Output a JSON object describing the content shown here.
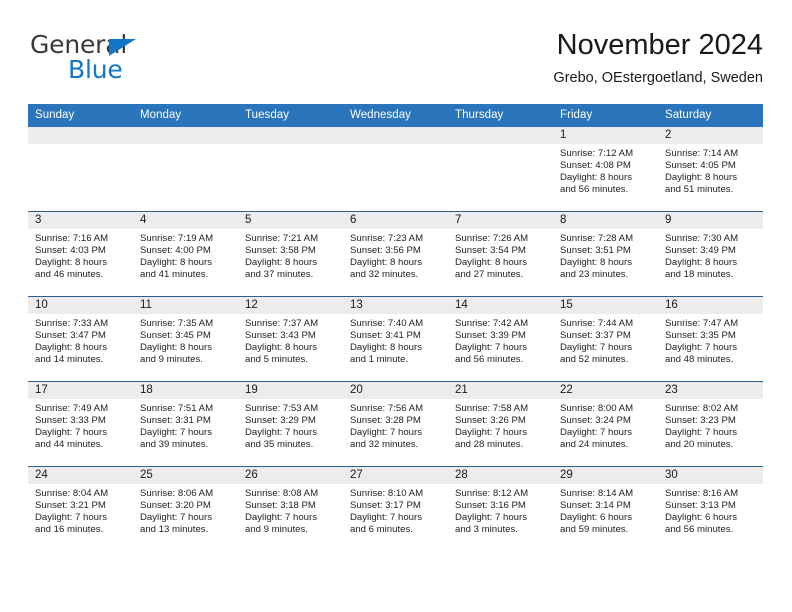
{
  "logo": {
    "word1": "General",
    "word2": "Blue",
    "triangle_color": "#1477c6"
  },
  "header": {
    "title": "November 2024",
    "subtitle": "Grebo, OEstergoetland, Sweden"
  },
  "theme": {
    "header_bg": "#2a74bb",
    "header_text": "#ffffff",
    "date_band_bg": "#ececec",
    "row_divider": "#2f5f8f"
  },
  "calendar": {
    "weekdays": [
      "Sunday",
      "Monday",
      "Tuesday",
      "Wednesday",
      "Thursday",
      "Friday",
      "Saturday"
    ],
    "weeks": [
      [
        {
          "day": "",
          "lines": []
        },
        {
          "day": "",
          "lines": []
        },
        {
          "day": "",
          "lines": []
        },
        {
          "day": "",
          "lines": []
        },
        {
          "day": "",
          "lines": []
        },
        {
          "day": "1",
          "lines": [
            "Sunrise: 7:12 AM",
            "Sunset: 4:08 PM",
            "Daylight: 8 hours",
            "and 56 minutes."
          ]
        },
        {
          "day": "2",
          "lines": [
            "Sunrise: 7:14 AM",
            "Sunset: 4:05 PM",
            "Daylight: 8 hours",
            "and 51 minutes."
          ]
        }
      ],
      [
        {
          "day": "3",
          "lines": [
            "Sunrise: 7:16 AM",
            "Sunset: 4:03 PM",
            "Daylight: 8 hours",
            "and 46 minutes."
          ]
        },
        {
          "day": "4",
          "lines": [
            "Sunrise: 7:19 AM",
            "Sunset: 4:00 PM",
            "Daylight: 8 hours",
            "and 41 minutes."
          ]
        },
        {
          "day": "5",
          "lines": [
            "Sunrise: 7:21 AM",
            "Sunset: 3:58 PM",
            "Daylight: 8 hours",
            "and 37 minutes."
          ]
        },
        {
          "day": "6",
          "lines": [
            "Sunrise: 7:23 AM",
            "Sunset: 3:56 PM",
            "Daylight: 8 hours",
            "and 32 minutes."
          ]
        },
        {
          "day": "7",
          "lines": [
            "Sunrise: 7:26 AM",
            "Sunset: 3:54 PM",
            "Daylight: 8 hours",
            "and 27 minutes."
          ]
        },
        {
          "day": "8",
          "lines": [
            "Sunrise: 7:28 AM",
            "Sunset: 3:51 PM",
            "Daylight: 8 hours",
            "and 23 minutes."
          ]
        },
        {
          "day": "9",
          "lines": [
            "Sunrise: 7:30 AM",
            "Sunset: 3:49 PM",
            "Daylight: 8 hours",
            "and 18 minutes."
          ]
        }
      ],
      [
        {
          "day": "10",
          "lines": [
            "Sunrise: 7:33 AM",
            "Sunset: 3:47 PM",
            "Daylight: 8 hours",
            "and 14 minutes."
          ]
        },
        {
          "day": "11",
          "lines": [
            "Sunrise: 7:35 AM",
            "Sunset: 3:45 PM",
            "Daylight: 8 hours",
            "and 9 minutes."
          ]
        },
        {
          "day": "12",
          "lines": [
            "Sunrise: 7:37 AM",
            "Sunset: 3:43 PM",
            "Daylight: 8 hours",
            "and 5 minutes."
          ]
        },
        {
          "day": "13",
          "lines": [
            "Sunrise: 7:40 AM",
            "Sunset: 3:41 PM",
            "Daylight: 8 hours",
            "and 1 minute."
          ]
        },
        {
          "day": "14",
          "lines": [
            "Sunrise: 7:42 AM",
            "Sunset: 3:39 PM",
            "Daylight: 7 hours",
            "and 56 minutes."
          ]
        },
        {
          "day": "15",
          "lines": [
            "Sunrise: 7:44 AM",
            "Sunset: 3:37 PM",
            "Daylight: 7 hours",
            "and 52 minutes."
          ]
        },
        {
          "day": "16",
          "lines": [
            "Sunrise: 7:47 AM",
            "Sunset: 3:35 PM",
            "Daylight: 7 hours",
            "and 48 minutes."
          ]
        }
      ],
      [
        {
          "day": "17",
          "lines": [
            "Sunrise: 7:49 AM",
            "Sunset: 3:33 PM",
            "Daylight: 7 hours",
            "and 44 minutes."
          ]
        },
        {
          "day": "18",
          "lines": [
            "Sunrise: 7:51 AM",
            "Sunset: 3:31 PM",
            "Daylight: 7 hours",
            "and 39 minutes."
          ]
        },
        {
          "day": "19",
          "lines": [
            "Sunrise: 7:53 AM",
            "Sunset: 3:29 PM",
            "Daylight: 7 hours",
            "and 35 minutes."
          ]
        },
        {
          "day": "20",
          "lines": [
            "Sunrise: 7:56 AM",
            "Sunset: 3:28 PM",
            "Daylight: 7 hours",
            "and 32 minutes."
          ]
        },
        {
          "day": "21",
          "lines": [
            "Sunrise: 7:58 AM",
            "Sunset: 3:26 PM",
            "Daylight: 7 hours",
            "and 28 minutes."
          ]
        },
        {
          "day": "22",
          "lines": [
            "Sunrise: 8:00 AM",
            "Sunset: 3:24 PM",
            "Daylight: 7 hours",
            "and 24 minutes."
          ]
        },
        {
          "day": "23",
          "lines": [
            "Sunrise: 8:02 AM",
            "Sunset: 3:23 PM",
            "Daylight: 7 hours",
            "and 20 minutes."
          ]
        }
      ],
      [
        {
          "day": "24",
          "lines": [
            "Sunrise: 8:04 AM",
            "Sunset: 3:21 PM",
            "Daylight: 7 hours",
            "and 16 minutes."
          ]
        },
        {
          "day": "25",
          "lines": [
            "Sunrise: 8:06 AM",
            "Sunset: 3:20 PM",
            "Daylight: 7 hours",
            "and 13 minutes."
          ]
        },
        {
          "day": "26",
          "lines": [
            "Sunrise: 8:08 AM",
            "Sunset: 3:18 PM",
            "Daylight: 7 hours",
            "and 9 minutes."
          ]
        },
        {
          "day": "27",
          "lines": [
            "Sunrise: 8:10 AM",
            "Sunset: 3:17 PM",
            "Daylight: 7 hours",
            "and 6 minutes."
          ]
        },
        {
          "day": "28",
          "lines": [
            "Sunrise: 8:12 AM",
            "Sunset: 3:16 PM",
            "Daylight: 7 hours",
            "and 3 minutes."
          ]
        },
        {
          "day": "29",
          "lines": [
            "Sunrise: 8:14 AM",
            "Sunset: 3:14 PM",
            "Daylight: 6 hours",
            "and 59 minutes."
          ]
        },
        {
          "day": "30",
          "lines": [
            "Sunrise: 8:16 AM",
            "Sunset: 3:13 PM",
            "Daylight: 6 hours",
            "and 56 minutes."
          ]
        }
      ]
    ]
  }
}
